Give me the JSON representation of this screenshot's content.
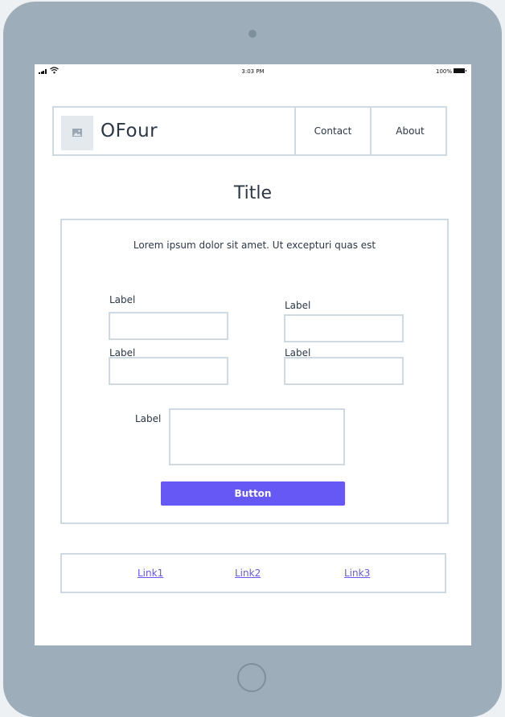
{
  "status_bar": {
    "time": "3:03 PM",
    "battery": "100%"
  },
  "header": {
    "brand": "OFour",
    "nav": [
      {
        "label": "Contact"
      },
      {
        "label": "About"
      }
    ]
  },
  "page": {
    "title": "Title"
  },
  "form": {
    "intro": "Lorem ipsum dolor sit amet. Ut excepturi quas est",
    "fields": [
      {
        "label": "Label",
        "value": ""
      },
      {
        "label": "Label",
        "value": ""
      },
      {
        "label": "Label",
        "value": ""
      },
      {
        "label": "Label",
        "value": ""
      },
      {
        "label": "Label",
        "value": ""
      }
    ],
    "button_label": "Button"
  },
  "footer": {
    "links": [
      {
        "label": "Link1"
      },
      {
        "label": "Link2"
      },
      {
        "label": "Link3"
      }
    ]
  },
  "colors": {
    "accent": "#6558f5",
    "border": "#cfd9e2",
    "text": "#2b3746",
    "device": "#9dadb9"
  }
}
